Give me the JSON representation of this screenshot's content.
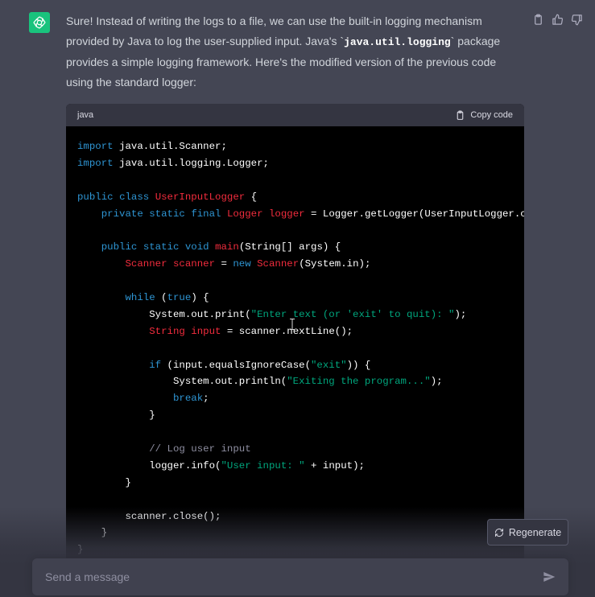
{
  "message": {
    "intro_1": "Sure! Instead of writing the logs to a file, we can use the built-in logging mechanism provided by Java to log the user-supplied input. Java's `",
    "intro_code": "java.util.logging",
    "intro_2": "` package provides a simple logging framework. Here's the modified version of the previous code using the standard logger:"
  },
  "code_block": {
    "language": "java",
    "copy_label": "Copy code",
    "lines": [
      [
        [
          "kw",
          "import"
        ],
        [
          "p",
          " java.util.Scanner;"
        ]
      ],
      [
        [
          "kw",
          "import"
        ],
        [
          "p",
          " java.util.logging.Logger;"
        ]
      ],
      [],
      [
        [
          "kw",
          "public"
        ],
        [
          "p",
          " "
        ],
        [
          "kw",
          "class"
        ],
        [
          "p",
          " "
        ],
        [
          "ty",
          "UserInputLogger"
        ],
        [
          "p",
          " {"
        ]
      ],
      [
        [
          "p",
          "    "
        ],
        [
          "kw",
          "private"
        ],
        [
          "p",
          " "
        ],
        [
          "kw",
          "static"
        ],
        [
          "p",
          " "
        ],
        [
          "kw",
          "final"
        ],
        [
          "p",
          " "
        ],
        [
          "ty",
          "Logger"
        ],
        [
          "p",
          " "
        ],
        [
          "ty",
          "logger"
        ],
        [
          "p",
          " = Logger.getLogger(UserInputLogger.cl"
        ]
      ],
      [],
      [
        [
          "p",
          "    "
        ],
        [
          "kw",
          "public"
        ],
        [
          "p",
          " "
        ],
        [
          "kw",
          "static"
        ],
        [
          "p",
          " "
        ],
        [
          "kw",
          "void"
        ],
        [
          "p",
          " "
        ],
        [
          "fn",
          "main"
        ],
        [
          "p",
          "(String[] args) {"
        ]
      ],
      [
        [
          "p",
          "        "
        ],
        [
          "ty",
          "Scanner"
        ],
        [
          "p",
          " "
        ],
        [
          "ty",
          "scanner"
        ],
        [
          "p",
          " = "
        ],
        [
          "kw",
          "new"
        ],
        [
          "p",
          " "
        ],
        [
          "ty",
          "Scanner"
        ],
        [
          "p",
          "(System.in);"
        ]
      ],
      [],
      [
        [
          "p",
          "        "
        ],
        [
          "kw",
          "while"
        ],
        [
          "p",
          " ("
        ],
        [
          "kw",
          "true"
        ],
        [
          "p",
          ") {"
        ]
      ],
      [
        [
          "p",
          "            System.out.print("
        ],
        [
          "st",
          "\"Enter text (or 'exit' to quit): \""
        ],
        [
          "p",
          ");"
        ]
      ],
      [
        [
          "p",
          "            "
        ],
        [
          "ty",
          "String"
        ],
        [
          "p",
          " "
        ],
        [
          "ty",
          "input"
        ],
        [
          "p",
          " = scanner.nextLine();"
        ]
      ],
      [],
      [
        [
          "p",
          "            "
        ],
        [
          "kw",
          "if"
        ],
        [
          "p",
          " (input.equalsIgnoreCase("
        ],
        [
          "st",
          "\"exit\""
        ],
        [
          "p",
          ")) {"
        ]
      ],
      [
        [
          "p",
          "                System.out.println("
        ],
        [
          "st",
          "\"Exiting the program...\""
        ],
        [
          "p",
          ");"
        ]
      ],
      [
        [
          "p",
          "                "
        ],
        [
          "kw",
          "break"
        ],
        [
          "p",
          ";"
        ]
      ],
      [
        [
          "p",
          "            }"
        ]
      ],
      [],
      [
        [
          "p",
          "            "
        ],
        [
          "cm",
          "// Log user input"
        ]
      ],
      [
        [
          "p",
          "            logger.info("
        ],
        [
          "st",
          "\"User input: \""
        ],
        [
          "p",
          " + input);"
        ]
      ],
      [
        [
          "p",
          "        }"
        ]
      ],
      [],
      [
        [
          "p",
          "        scanner.close();"
        ]
      ],
      [
        [
          "p",
          "    }"
        ]
      ],
      [
        [
          "p",
          "}"
        ]
      ]
    ]
  },
  "regenerate_label": "Regenerate",
  "composer": {
    "placeholder": "Send a message",
    "value": ""
  },
  "colors": {
    "bg": "#444654",
    "avatar": "#19c37d",
    "code_bg": "#000000",
    "keyword": "#2e95d3",
    "type": "#f22c3d",
    "string": "#00a67d",
    "comment": "#8e8ea0"
  },
  "icons": {
    "avatar": "openai-logo-icon",
    "copy": "clipboard-icon",
    "thumbs_up": "thumbs-up-icon",
    "thumbs_down": "thumbs-down-icon",
    "regenerate": "refresh-icon",
    "send": "send-icon"
  }
}
